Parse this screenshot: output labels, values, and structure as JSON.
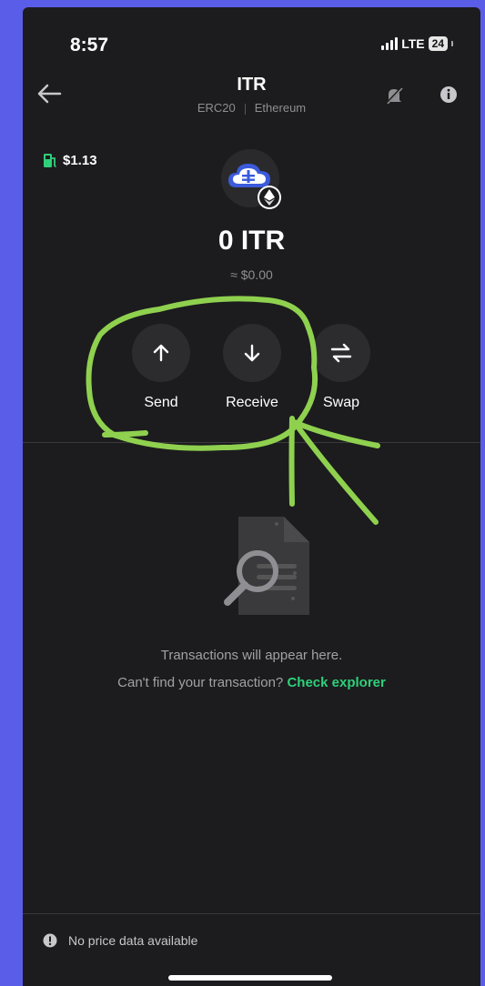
{
  "status_bar": {
    "time": "8:57",
    "network": "LTE",
    "battery": "24"
  },
  "header": {
    "title": "ITR",
    "standard": "ERC20",
    "network": "Ethereum"
  },
  "gas": {
    "value": "$1.13"
  },
  "balance": {
    "amount": "0 ITR",
    "fiat": "≈ $0.00"
  },
  "actions": [
    {
      "label": "Send",
      "icon": "arrow-up-icon"
    },
    {
      "label": "Receive",
      "icon": "arrow-down-icon"
    },
    {
      "label": "Swap",
      "icon": "swap-icon"
    }
  ],
  "empty_state": {
    "line1": "Transactions will appear here.",
    "line2": "Can't find your transaction?",
    "link": "Check explorer"
  },
  "footer": {
    "notice": "No price data available"
  },
  "colors": {
    "background": "#1c1c1e",
    "accent_green": "#2fd07a",
    "annotation": "#8fd14f",
    "frame": "#5a5de8"
  }
}
